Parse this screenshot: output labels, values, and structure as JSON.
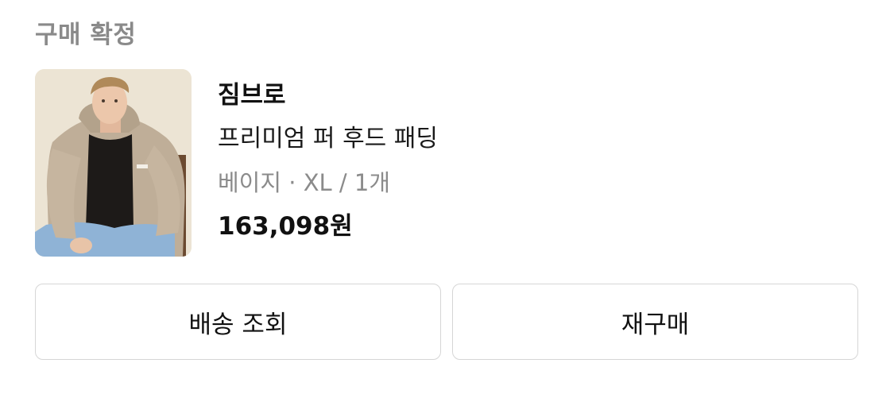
{
  "order": {
    "status_title": "구매 확정",
    "product": {
      "brand": "짐브로",
      "name": "프리미엄 퍼 후드 패딩",
      "option": "베이지 · XL / 1개",
      "price": "163,098원"
    },
    "actions": {
      "track_delivery_label": "배송 조회",
      "repurchase_label": "재구매"
    }
  }
}
